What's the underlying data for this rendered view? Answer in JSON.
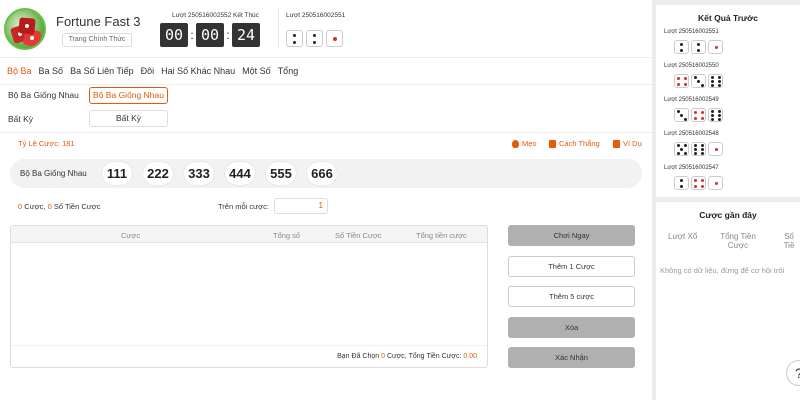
{
  "header": {
    "title": "Fortune Fast 3",
    "subtitle_button": "Trang Chính Thức",
    "current_round": "Lượt 250516002552 Kết Thúc",
    "timer": {
      "hours": "00",
      "minutes": "00",
      "seconds": "24"
    },
    "last_round": "Lượt 250516002551"
  },
  "tabs": [
    "Bộ Ba",
    "Ba Số",
    "Ba Số Liên Tiếp",
    "Đôi",
    "Hai Số Khác Nhau",
    "Một Số",
    "Tổng"
  ],
  "subrows": {
    "row1_label": "Bộ Ba Giống Nhau",
    "row1_chip": "Bộ Ba Giống Nhau",
    "row2_label": "Bất Kỳ",
    "row2_chip": "Bất Kỳ"
  },
  "odds": "Tỷ Lệ Cược: 181",
  "tools": {
    "tips": "Mẹo",
    "how_to_win": "Cách Thắng",
    "example": "Ví Dụ"
  },
  "bet": {
    "label": "Bộ Ba Giống Nhau",
    "options": [
      "111",
      "222",
      "333",
      "444",
      "555",
      "666"
    ]
  },
  "stats": {
    "bets_count": "0",
    "bets_label": "Cược,",
    "amount_count": "0",
    "amount_label": "Số Tiền Cược"
  },
  "per_bet": {
    "label": "Trên mỗi cược:",
    "value": "1"
  },
  "table": {
    "headers": [
      "Cược",
      "Tổng số",
      "Số Tiền Cược",
      "Tổng tiền cược"
    ],
    "footer_prefix": "Bạn Đã Chọn",
    "footer_count": "0",
    "footer_mid": "Cược, Tổng Tiền Cược:",
    "footer_amount": "0.00"
  },
  "actions": {
    "play_now": "Chơi Ngay",
    "add_1": "Thêm 1 Cược",
    "add_5": "Thêm 5 cược",
    "delete": "Xóa",
    "confirm": "Xác Nhận"
  },
  "results": {
    "title": "Kết Quả Trước",
    "items": [
      {
        "round": "Lượt 250516002551",
        "dice": [
          2,
          2,
          1
        ]
      },
      {
        "round": "Lượt 250516002550",
        "dice": [
          4,
          3,
          6
        ]
      },
      {
        "round": "Lượt 250516002549",
        "dice": [
          3,
          4,
          6
        ]
      },
      {
        "round": "Lượt 250516002548",
        "dice": [
          5,
          6,
          1
        ]
      },
      {
        "round": "Lượt 250516002547",
        "dice": [
          2,
          4,
          1
        ]
      }
    ]
  },
  "history": {
    "title": "Cược gần đây",
    "headers": [
      "Lượt Xổ",
      "Tổng Tiền Cược",
      "Số Tiề"
    ],
    "empty": "Không có dữ liệu, đừng để cơ hội trôi"
  },
  "colors": {
    "accent": "#e55a0c",
    "timer_bg": "#333333"
  }
}
